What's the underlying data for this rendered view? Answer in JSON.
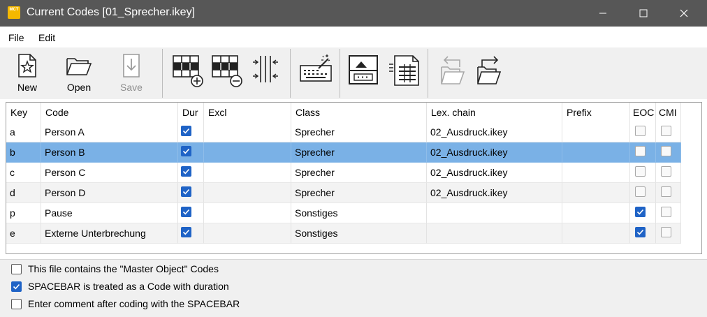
{
  "window": {
    "title": "Current Codes [01_Sprecher.ikey]",
    "app_icon_text": "MCT"
  },
  "menu": {
    "items": [
      "File",
      "Edit"
    ]
  },
  "toolbar": {
    "new_label": "New",
    "open_label": "Open",
    "save_label": "Save",
    "save_enabled": false
  },
  "table": {
    "columns": [
      "Key",
      "Code",
      "Dur",
      "Excl",
      "Class",
      "Lex. chain",
      "Prefix",
      "EOC",
      "CMI"
    ],
    "selected_row": 1,
    "rows": [
      {
        "key": "a",
        "code": "Person A",
        "dur": true,
        "excl": "",
        "class": "Sprecher",
        "lex": "02_Ausdruck.ikey",
        "prefix": "",
        "eoc": false,
        "cmi": false
      },
      {
        "key": "b",
        "code": "Person B",
        "dur": true,
        "excl": "",
        "class": "Sprecher",
        "lex": "02_Ausdruck.ikey",
        "prefix": "",
        "eoc": false,
        "cmi": false
      },
      {
        "key": "c",
        "code": "Person C",
        "dur": true,
        "excl": "",
        "class": "Sprecher",
        "lex": "02_Ausdruck.ikey",
        "prefix": "",
        "eoc": false,
        "cmi": false
      },
      {
        "key": "d",
        "code": "Person D",
        "dur": true,
        "excl": "",
        "class": "Sprecher",
        "lex": "02_Ausdruck.ikey",
        "prefix": "",
        "eoc": false,
        "cmi": false
      },
      {
        "key": "p",
        "code": "Pause",
        "dur": true,
        "excl": "",
        "class": "Sonstiges",
        "lex": "",
        "prefix": "",
        "eoc": true,
        "cmi": false
      },
      {
        "key": "e",
        "code": "Externe Unterbrechung",
        "dur": true,
        "excl": "",
        "class": "Sonstiges",
        "lex": "",
        "prefix": "",
        "eoc": true,
        "cmi": false
      }
    ]
  },
  "options": [
    {
      "label": "This file contains the \"Master Object\" Codes",
      "checked": false
    },
    {
      "label": "SPACEBAR is treated as a Code with duration",
      "checked": true
    },
    {
      "label": "Enter comment after coding with the SPACEBAR",
      "checked": false
    }
  ],
  "colors": {
    "titlebar": "#575757",
    "selection": "#7ab1e6",
    "checkbox_on": "#1f63c6",
    "app_icon": "#f5b800"
  }
}
